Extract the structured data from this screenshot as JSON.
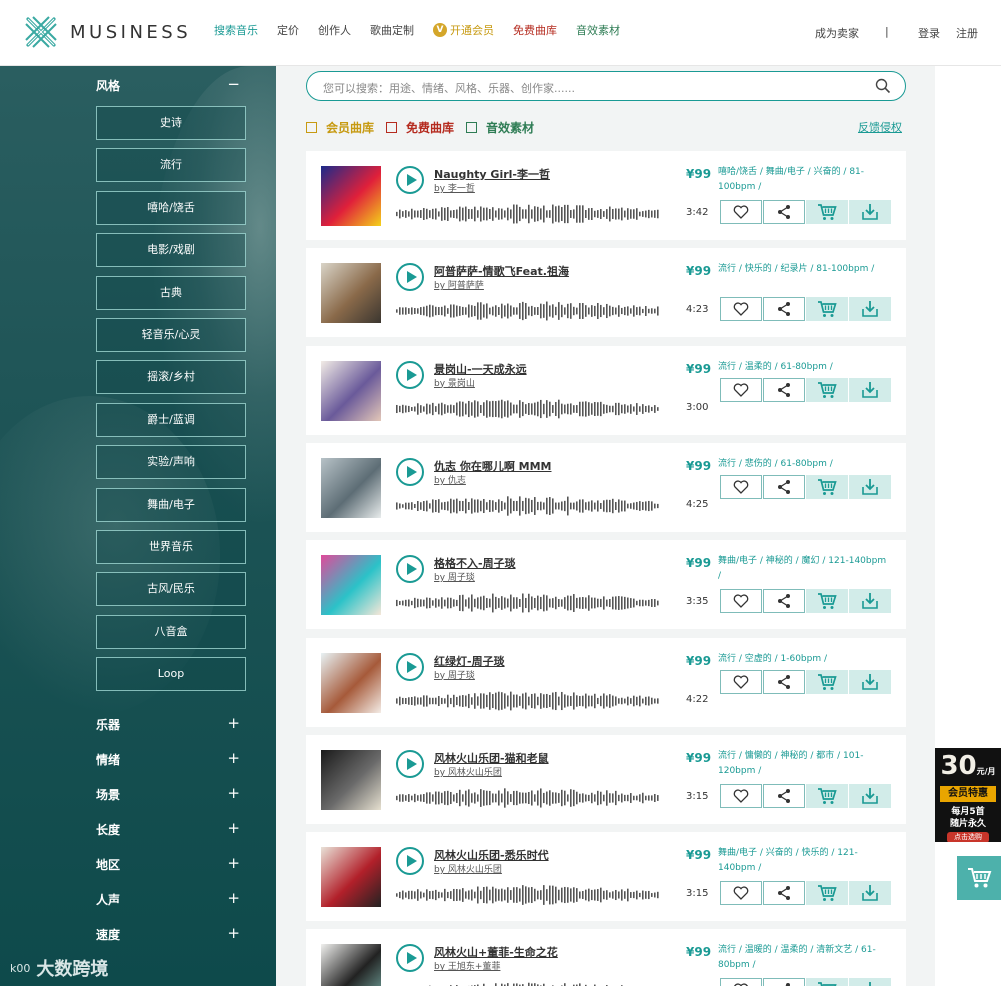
{
  "brand": {
    "name": "MUSINESS"
  },
  "nav": {
    "items": [
      "搜索音乐",
      "定价",
      "创作人",
      "歌曲定制",
      "开通会员",
      "免费曲库",
      "音效素材"
    ],
    "vip_badge": "V"
  },
  "header_right": {
    "seller": "成为卖家",
    "divider": "|",
    "login": "登录",
    "register": "注册"
  },
  "sidebar": {
    "style_heading": "风格",
    "style_toggle": "−",
    "styles": [
      "史诗",
      "流行",
      "嘻哈/饶舌",
      "电影/戏剧",
      "古典",
      "轻音乐/心灵",
      "摇滚/乡村",
      "爵士/蓝调",
      "实验/声响",
      "舞曲/电子",
      "世界音乐",
      "古风/民乐",
      "八音盒",
      "Loop"
    ],
    "categories": [
      {
        "label": "乐器",
        "sign": "+"
      },
      {
        "label": "情绪",
        "sign": "+"
      },
      {
        "label": "场景",
        "sign": "+"
      },
      {
        "label": "长度",
        "sign": "+"
      },
      {
        "label": "地区",
        "sign": "+"
      },
      {
        "label": "人声",
        "sign": "+"
      },
      {
        "label": "速度",
        "sign": "+"
      }
    ]
  },
  "search": {
    "placeholder": "您可以搜索：用途、情绪、风格、乐器、创作家......"
  },
  "filters": [
    {
      "label": "会员曲库",
      "color": "#c79a12"
    },
    {
      "label": "免费曲库",
      "color": "#b52b1f"
    },
    {
      "label": "音效素材",
      "color": "#2e7c54"
    }
  ],
  "feedback": "反馈侵权",
  "tracks": [
    {
      "title": "Naughty Girl-李一哲",
      "artist": "by 李一哲",
      "price": "¥99",
      "duration": "3:42",
      "tags": "嘻哈/饶舌 / 舞曲/电子 / 兴奋的 / 81-100bpm /",
      "cover": [
        "#1b2a8a",
        "#e0203a",
        "#f4d21a"
      ]
    },
    {
      "title": "阿普萨萨-情歌飞Feat.祖海",
      "artist": "by 阿普萨萨",
      "price": "¥99",
      "duration": "4:23",
      "tags": "流行 / 快乐的 / 纪录片 / 81-100bpm /",
      "cover": [
        "#d9d4c8",
        "#8a6a4a",
        "#3b3630"
      ]
    },
    {
      "title": "景岗山-一天成永远",
      "artist": "by 景岗山",
      "price": "¥99",
      "duration": "3:00",
      "tags": "流行 / 温柔的 / 61-80bpm /",
      "cover": [
        "#f2ece6",
        "#6a5a9a",
        "#e3c7b8"
      ]
    },
    {
      "title": "仇志 你在哪儿啊 MMM",
      "artist": "by 仇志",
      "price": "¥99",
      "duration": "4:25",
      "tags": "流行 / 悲伤的 / 61-80bpm /",
      "cover": [
        "#b7c2c7",
        "#5d6d75",
        "#e8ecec"
      ]
    },
    {
      "title": "格格不入-周子琰",
      "artist": "by 周子琰",
      "price": "¥99",
      "duration": "3:35",
      "tags": "舞曲/电子 / 神秘的 / 魔幻 / 121-140bpm /",
      "cover": [
        "#e04a9a",
        "#2bc2c8",
        "#f6e7d8"
      ]
    },
    {
      "title": "红绿灯-周子琰",
      "artist": "by 周子琰",
      "price": "¥99",
      "duration": "4:22",
      "tags": "流行 / 空虚的 / 1-60bpm /",
      "cover": [
        "#e8f2f4",
        "#a65a3a",
        "#f4ece6"
      ]
    },
    {
      "title": "风林火山乐团-猫和老鼠",
      "artist": "by 风林火山乐团",
      "price": "¥99",
      "duration": "3:15",
      "tags": "流行 / 慵懒的 / 神秘的 / 都市 / 101-120bpm /",
      "cover": [
        "#1a1a1a",
        "#6a6a6a",
        "#e6e0d0"
      ]
    },
    {
      "title": "风林火山乐团-悉乐时代",
      "artist": "by 风林火山乐团",
      "price": "¥99",
      "duration": "3:15",
      "tags": "舞曲/电子 / 兴奋的 / 快乐的 / 121-140bpm /",
      "cover": [
        "#e9e2d8",
        "#b2202a",
        "#222222"
      ]
    },
    {
      "title": "风林火山+董菲-生命之花",
      "artist": "by 王旭东+董菲",
      "price": "¥99",
      "duration": "",
      "tags": "流行 / 温暖的 / 温柔的 / 清新文艺 / 61-80bpm /",
      "cover": [
        "#f0f0ee",
        "#222222",
        "#7ab0a8"
      ]
    }
  ],
  "promo": {
    "amount": "30",
    "unit": "元/月",
    "tag": "会员特惠",
    "line1": "每月5首",
    "line2": "随片永久",
    "button": "点击选购"
  },
  "watermark": {
    "prefix": "k00",
    "text": "大数跨境"
  },
  "colors": {
    "accent": "#1a9a94",
    "sidebar": "#1f5557",
    "vip": "#c79a12",
    "free": "#b52b1f",
    "sfx": "#2e7c54"
  }
}
